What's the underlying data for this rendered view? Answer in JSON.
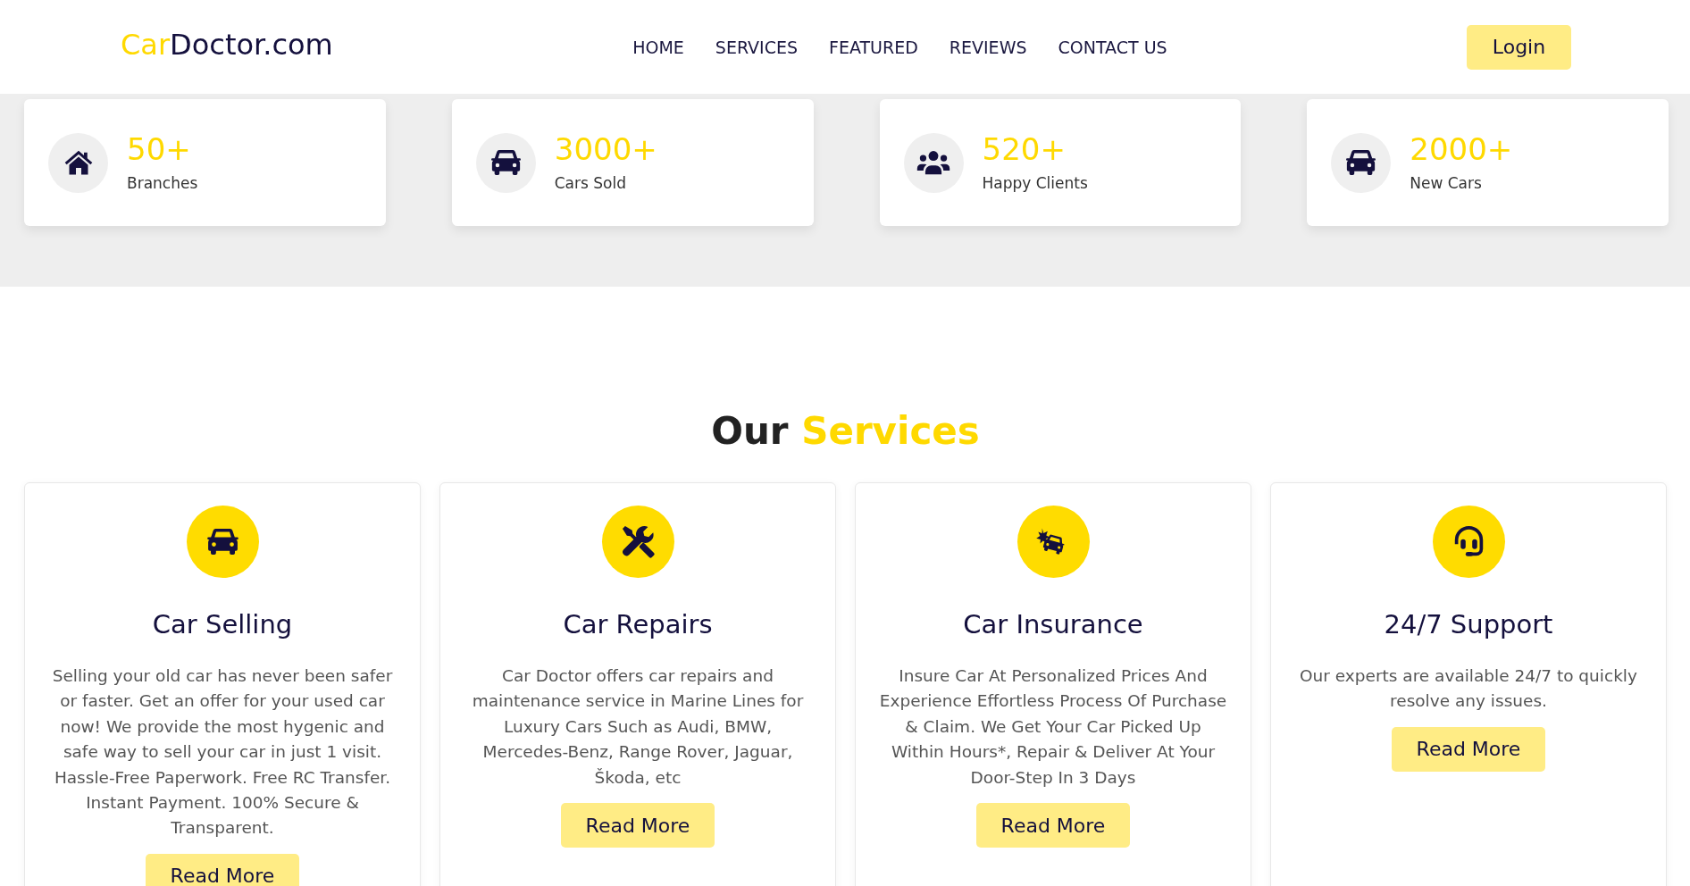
{
  "header": {
    "logo": {
      "accent": "Car",
      "rest": "Doctor.com"
    },
    "nav": [
      "HOME",
      "SERVICES",
      "FEATURED",
      "REVIEWS",
      "CONTACT US"
    ],
    "login_button": "Login"
  },
  "stats": [
    {
      "value": "50+",
      "label": "Branches"
    },
    {
      "value": "3000+",
      "label": "Cars Sold"
    },
    {
      "value": "520+",
      "label": "Happy Clients"
    },
    {
      "value": "2000+",
      "label": "New Cars"
    }
  ],
  "services": {
    "title": {
      "plain": "Our",
      "accent": "Services"
    },
    "cards": [
      {
        "title": "Car Selling",
        "description": "Selling your old car has never been safer or faster. Get an offer for your used car now! We provide the most hygenic and safe way to sell your car in just 1 visit. Hassle-Free Paperwork. Free RC Transfer. Instant Payment. 100% Secure & Transparent.",
        "button": "Read More"
      },
      {
        "title": "Car Repairs",
        "description": "Car Doctor offers car repairs and maintenance service in Marine Lines for Luxury Cars Such as Audi, BMW, Mercedes-Benz, Range Rover, Jaguar, Škoda, etc",
        "button": "Read More"
      },
      {
        "title": "Car Insurance",
        "description": "Insure Car At Personalized Prices And Experience Effortless Process Of Purchase & Claim. We Get Your Car Picked Up Within Hours*, Repair & Deliver At Your Door-Step In 3 Days",
        "button": "Read More"
      },
      {
        "title": "24/7 Support",
        "description": "Our experts are available 24/7 to quickly resolve any issues.",
        "button": "Read More"
      }
    ]
  }
}
